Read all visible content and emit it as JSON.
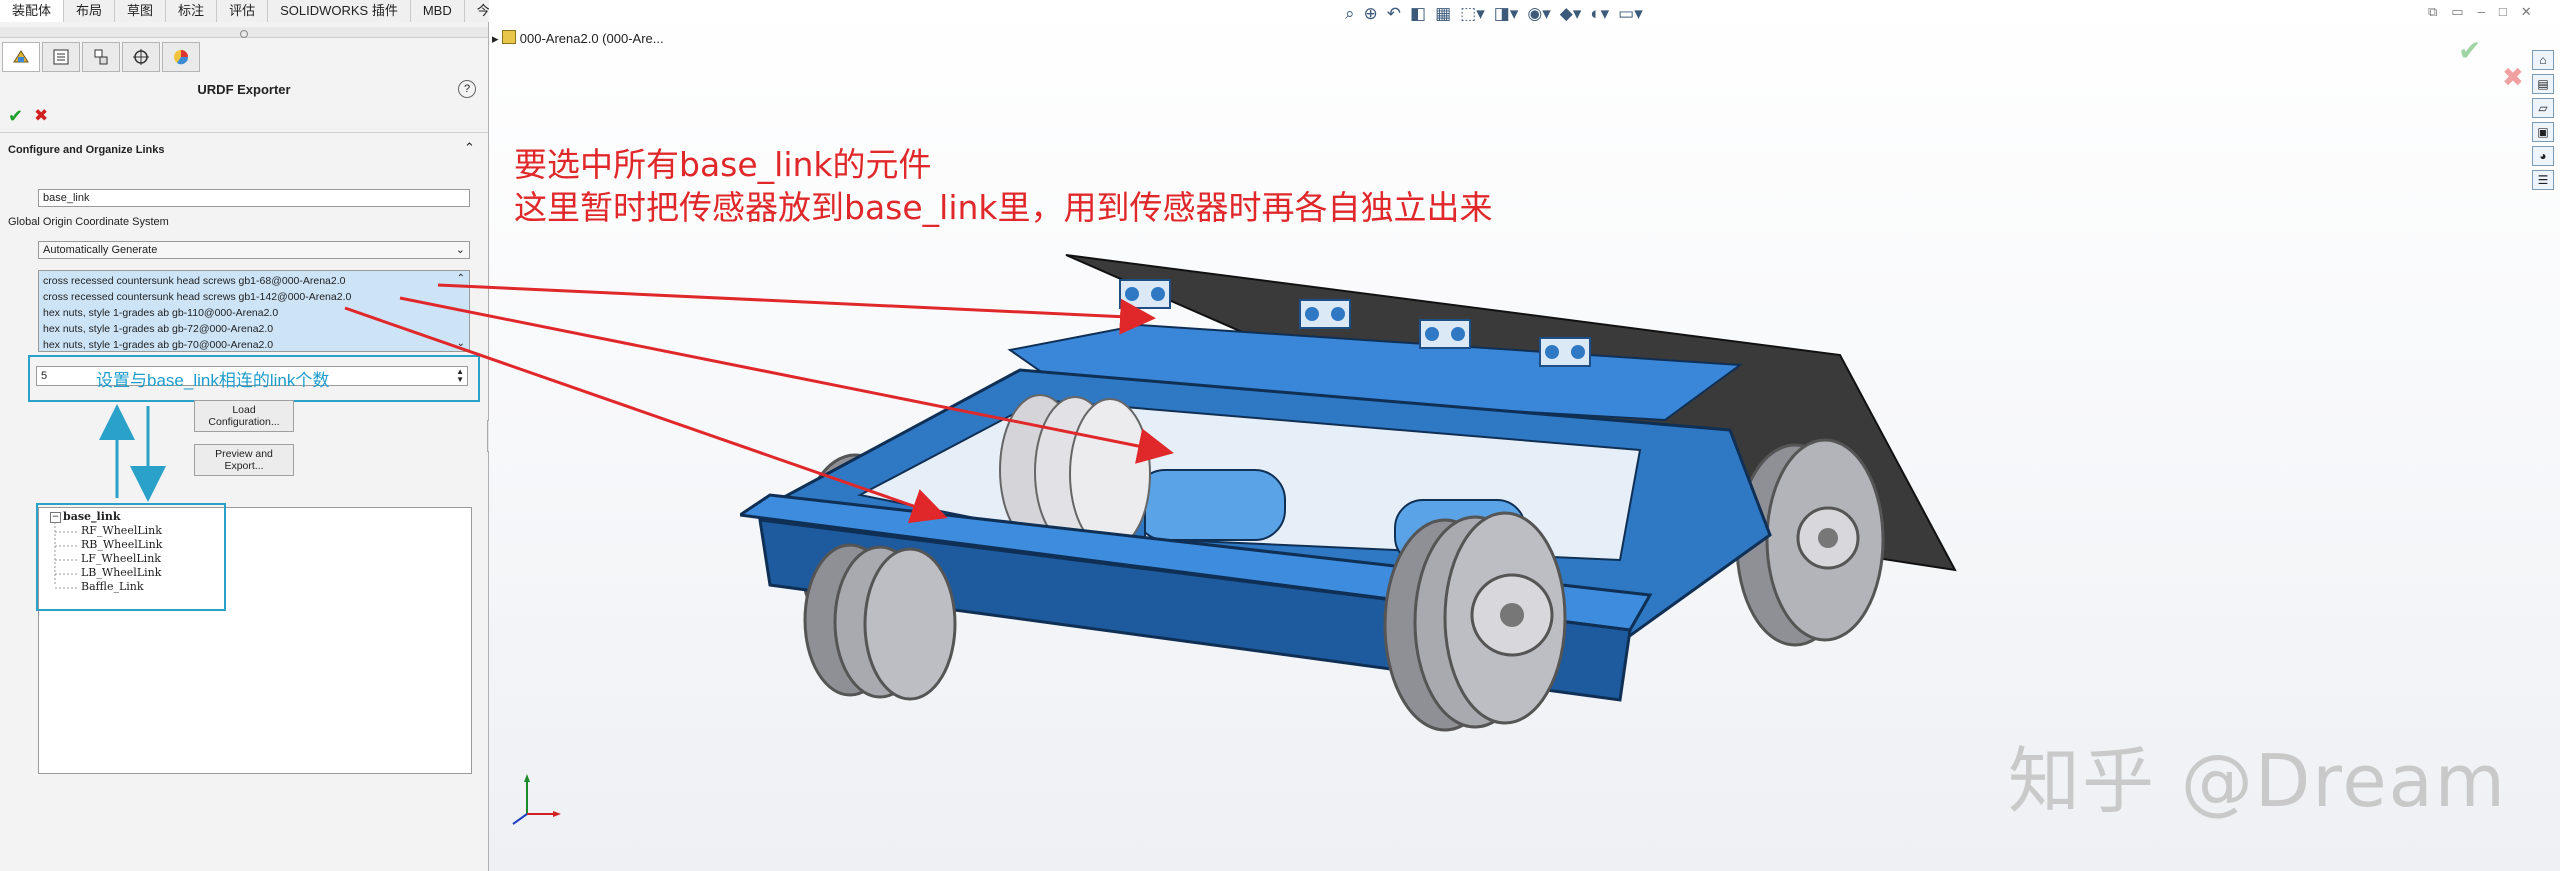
{
  "tabs": [
    {
      "label": "装配体",
      "active": true
    },
    {
      "label": "布局",
      "active": false
    },
    {
      "label": "草图",
      "active": false
    },
    {
      "label": "标注",
      "active": false
    },
    {
      "label": "评估",
      "active": false
    },
    {
      "label": "SOLIDWORKS 插件",
      "active": false
    },
    {
      "label": "MBD",
      "active": false
    },
    {
      "label": "今日制造",
      "active": false
    }
  ],
  "manager_tabs": [
    "feature-manager",
    "property-manager",
    "configuration-manager",
    "dimxpert-manager",
    "display-manager"
  ],
  "property_manager": {
    "title": "URDF Exporter",
    "help_symbol": "?",
    "ok_symbol": "✔",
    "cancel_symbol": "✖",
    "group_title": "Configure and Organize Links",
    "link_name": "base_link",
    "origin_label": "Global Origin Coordinate System",
    "origin_value": "Automatically Generate",
    "components": [
      "cross recessed countersunk head screws gb1-68@000-Arena2.0",
      "cross recessed countersunk head screws gb1-142@000-Arena2.0",
      "hex nuts, style 1-grades ab gb-110@000-Arena2.0",
      "hex nuts, style 1-grades ab gb-72@000-Arena2.0",
      "hex nuts, style 1-grades ab gb-70@000-Arena2.0"
    ],
    "child_count": "5",
    "load_button": [
      "Load",
      "Configuration..."
    ],
    "export_button": [
      "Preview and",
      "Export..."
    ],
    "tree_root": "base_link",
    "tree_children": [
      "RF_WheelLink",
      "RB_WheelLink",
      "LF_WheelLink",
      "LB_WheelLink",
      "Baffle_Link"
    ]
  },
  "viewport": {
    "document_name": "000-Arena2.0  (000-Are...",
    "hud_icons": [
      "zoom-fit-icon",
      "zoom-area-icon",
      "previous-view-icon",
      "section-view-icon",
      "dynamic-annotation-icon",
      "view-orientation-icon",
      "display-style-icon",
      "hide-show-icon",
      "edit-appearance-icon",
      "apply-scene-icon",
      "view-settings-icon"
    ],
    "window_controls": [
      "restore-icon",
      "tile-icon",
      "minimize-icon",
      "maximize-icon",
      "close-icon"
    ],
    "confirm_ok": "✔",
    "confirm_cancel": "✖",
    "task_pane_icons": [
      "resources-icon",
      "design-library-icon",
      "file-explorer-icon",
      "view-palette-icon",
      "appearances-icon",
      "custom-properties-icon"
    ]
  },
  "annotations": {
    "line1": "要选中所有base_link的元件",
    "line2": "这里暂时把传感器放到base_link里，用到传感器时再各自独立出来",
    "count_note": "设置与base_link相连的link个数",
    "color_red": "#e0282a",
    "color_blue": "#2aa1c9"
  },
  "watermark": "知乎 @Dream",
  "colors": {
    "chassis_blue": "#2f78c4",
    "chassis_dark": "#1d4f86",
    "baffle": "#3a3a3a",
    "wheel": "#9a9aa2"
  }
}
